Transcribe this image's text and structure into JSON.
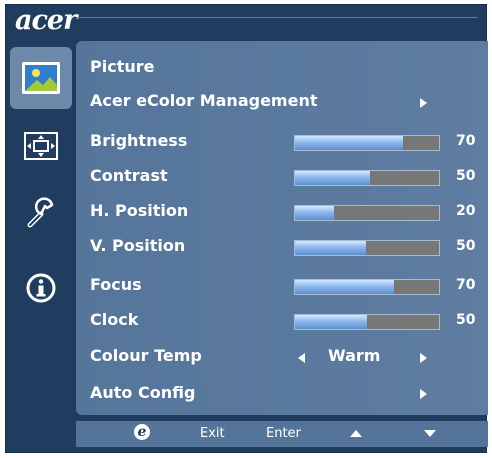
{
  "brand": {
    "logo_text": "acer"
  },
  "tabs": [
    {
      "icon": "picture-icon",
      "active": true
    },
    {
      "icon": "position-icon",
      "active": false
    },
    {
      "icon": "settings-icon",
      "active": false
    },
    {
      "icon": "info-icon",
      "active": false
    }
  ],
  "menu": {
    "section_title": "Picture",
    "ecolor": {
      "label": "Acer eColor Management"
    },
    "sliders": [
      {
        "label": "Brightness",
        "value": "70",
        "level": 0.75
      },
      {
        "label": "Contrast",
        "value": "50",
        "level": 0.52
      },
      {
        "label": "H. Position",
        "value": "20",
        "level": 0.27
      },
      {
        "label": "V. Position",
        "value": "50",
        "level": 0.49
      },
      {
        "label": "Focus",
        "value": "70",
        "level": 0.69
      },
      {
        "label": "Clock",
        "value": "50",
        "level": 0.5
      }
    ],
    "colour_temp": {
      "label": "Colour Temp",
      "value": "Warm"
    },
    "auto_config": {
      "label": "Auto Config"
    }
  },
  "keybar": {
    "e_key": "e",
    "exit": "Exit",
    "enter": "Enter"
  },
  "colors": {
    "background": "#203c5e",
    "panel": "#5a799e",
    "active_tab": "#6d89a9",
    "bar_fill": "#8db8ec",
    "bar_empty": "#777777"
  }
}
